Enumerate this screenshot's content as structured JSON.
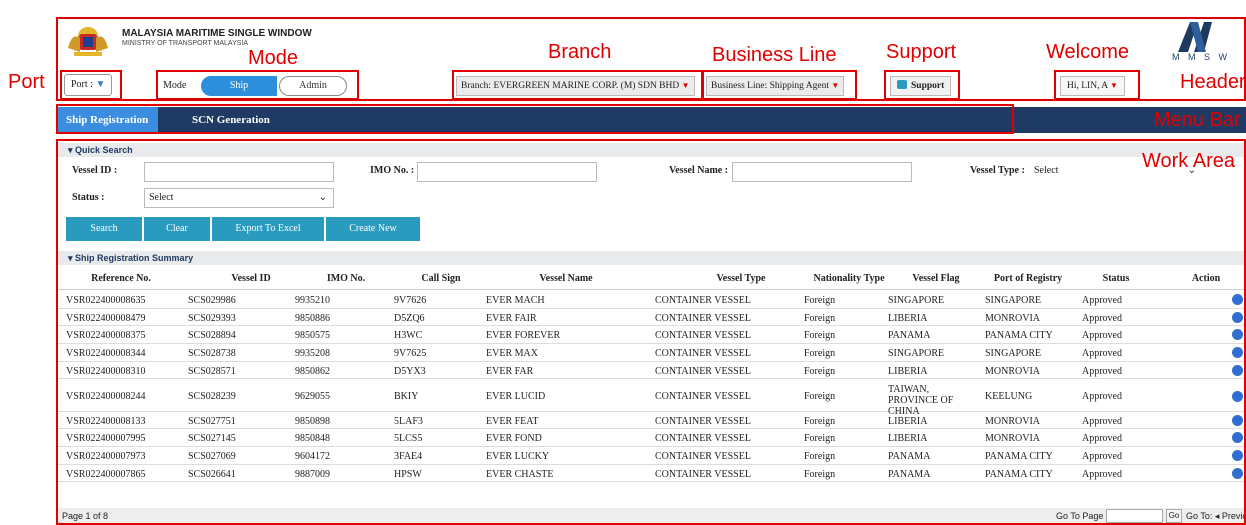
{
  "annotations": {
    "mode": "Mode",
    "branch": "Branch",
    "business_line": "Business Line",
    "support": "Support",
    "welcome": "Welcome",
    "port": "Port",
    "header": "Header",
    "menu_bar": "Menu Bar",
    "work_area": "Work Area",
    "color": "#e00000"
  },
  "header": {
    "title": "MALAYSIA MARITIME SINGLE WINDOW",
    "subtitle": "MINISTRY OF TRANSPORT MALAYSIA",
    "brand": "M M S W",
    "port_label": "Port :",
    "mode_label": "Mode",
    "mode_options": [
      "Ship",
      "Admin"
    ],
    "mode_selected": "Ship",
    "branch": "Branch: EVERGREEN MARINE CORP. (M) SDN BHD",
    "business_line": "Business Line: Shipping Agent",
    "support": "Support",
    "welcome": "Hi, LIN, A"
  },
  "menu": {
    "items": [
      "Ship Registration",
      "SCN Generation"
    ],
    "active": "Ship Registration"
  },
  "quick_search": {
    "title": "Quick Search",
    "vessel_id_label": "Vessel ID :",
    "imo_label": "IMO No. :",
    "vessel_name_label": "Vessel Name :",
    "vessel_type_label": "Vessel Type :",
    "vessel_type_value": "Select",
    "status_label": "Status :",
    "status_value": "Select",
    "buttons": [
      "Search",
      "Clear",
      "Export To Excel",
      "Create New"
    ]
  },
  "summary": {
    "title": "Ship Registration Summary",
    "columns": [
      "Reference No.",
      "Vessel ID",
      "IMO No.",
      "Call Sign",
      "Vessel Name",
      "Vessel Type",
      "Nationality Type",
      "Vessel Flag",
      "Port of Registry",
      "Status",
      "Action"
    ],
    "rows": [
      [
        "VSR022400008635",
        "SCS029986",
        "9935210",
        "9V7626",
        "EVER MACH",
        "CONTAINER VESSEL",
        "Foreign",
        "SINGAPORE",
        "SINGAPORE",
        "Approved"
      ],
      [
        "VSR022400008479",
        "SCS029393",
        "9850886",
        "D5ZQ6",
        "EVER FAIR",
        "CONTAINER VESSEL",
        "Foreign",
        "LIBERIA",
        "MONROVIA",
        "Approved"
      ],
      [
        "VSR022400008375",
        "SCS028894",
        "9850575",
        "H3WC",
        "EVER FOREVER",
        "CONTAINER VESSEL",
        "Foreign",
        "PANAMA",
        "PANAMA CITY",
        "Approved"
      ],
      [
        "VSR022400008344",
        "SCS028738",
        "9935208",
        "9V7625",
        "EVER MAX",
        "CONTAINER VESSEL",
        "Foreign",
        "SINGAPORE",
        "SINGAPORE",
        "Approved"
      ],
      [
        "VSR022400008310",
        "SCS028571",
        "9850862",
        "D5YX3",
        "EVER FAR",
        "CONTAINER VESSEL",
        "Foreign",
        "LIBERIA",
        "MONROVIA",
        "Approved"
      ],
      [
        "VSR022400008244",
        "SCS028239",
        "9629055",
        "BKIY",
        "EVER LUCID",
        "CONTAINER VESSEL",
        "Foreign",
        "TAIWAN, PROVINCE OF CHINA",
        "KEELUNG",
        "Approved"
      ],
      [
        "VSR022400008133",
        "SCS027751",
        "9850898",
        "5LAF3",
        "EVER FEAT",
        "CONTAINER VESSEL",
        "Foreign",
        "LIBERIA",
        "MONROVIA",
        "Approved"
      ],
      [
        "VSR022400007995",
        "SCS027145",
        "9850848",
        "5LCS5",
        "EVER FOND",
        "CONTAINER VESSEL",
        "Foreign",
        "LIBERIA",
        "MONROVIA",
        "Approved"
      ],
      [
        "VSR022400007973",
        "SCS027069",
        "9604172",
        "3FAE4",
        "EVER LUCKY",
        "CONTAINER VESSEL",
        "Foreign",
        "PANAMA",
        "PANAMA CITY",
        "Approved"
      ],
      [
        "VSR022400007865",
        "SCS026641",
        "9887009",
        "HPSW",
        "EVER CHASTE",
        "CONTAINER VESSEL",
        "Foreign",
        "PANAMA",
        "PANAMA CITY",
        "Approved"
      ]
    ],
    "action_icons": [
      "edit-icon",
      "view-icon",
      "cancel-icon",
      "delete-icon"
    ]
  },
  "pagination": {
    "page_info": "Page 1 of 8",
    "go_to_page": "Go To Page",
    "go": "Go",
    "nav": "Go To: ◂ Previous  |  Next ▸"
  }
}
